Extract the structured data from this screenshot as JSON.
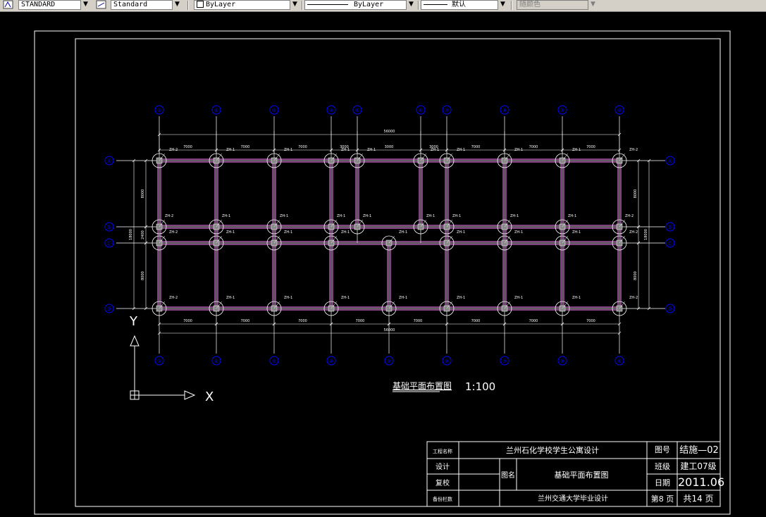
{
  "toolbar": {
    "text_style": "STANDARD",
    "dim_style": "Standard",
    "layer": "ByLayer",
    "linetype": "ByLayer",
    "lineweight": "默认",
    "plot_style": "随颜色"
  },
  "grid": {
    "top_labels": [
      "①",
      "②",
      "③",
      "④",
      "⑤",
      "⑥",
      "⑦",
      "⑧",
      "⑨",
      "⑩"
    ],
    "bottom_labels": [
      "①",
      "②",
      "③",
      "④",
      "⑤",
      "⑥",
      "⑦",
      "⑧",
      "⑨",
      "⑩"
    ],
    "side_labels": [
      "Ⓐ",
      "Ⓑ",
      "Ⓒ",
      "Ⓓ"
    ]
  },
  "dims": {
    "top_total": "56000",
    "bottom_total": "56000",
    "top_spans": [
      "7000",
      "7000",
      "7000",
      "3000",
      "3000",
      "3000",
      "7000",
      "7000",
      "7000"
    ],
    "bottom_spans": [
      "7000",
      "7000",
      "7000",
      "7000",
      "7000",
      "7000",
      "7000",
      "7000"
    ],
    "left_total": "18000",
    "left_spans": [
      "8000",
      "2400",
      "8000"
    ],
    "right_total": "18000",
    "right_spans": [
      "8000",
      "",
      "8000"
    ]
  },
  "columns": {
    "zh1": "ZH-1",
    "zh2": "ZH-2"
  },
  "drawing": {
    "title": "基础平面布置图",
    "scale": "1:100",
    "ucs_x": "X",
    "ucs_y": "Y"
  },
  "title_block": {
    "project_label": "工程名称",
    "project_value": "兰州石化学校学生公寓设计",
    "design_label": "设计",
    "review_label": "复校",
    "drawing_name_label": "图名",
    "drawing_name_value": "基础平面布置图",
    "remark_label": "备份栏数",
    "university": "兰州交通大学毕业设计",
    "no_label": "图号",
    "no_value": "结施—02",
    "class_label": "班级",
    "class_value": "建工07级",
    "date_label": "日期",
    "date_value": "2011.06",
    "page_label": "第8 页",
    "total_label": "共14 页"
  },
  "colors": {
    "background": "#000000",
    "frame": "#ffffff",
    "axis_bubble": "#0000ff",
    "beam": "#ff80ff",
    "grid_line": "#ffffff"
  }
}
